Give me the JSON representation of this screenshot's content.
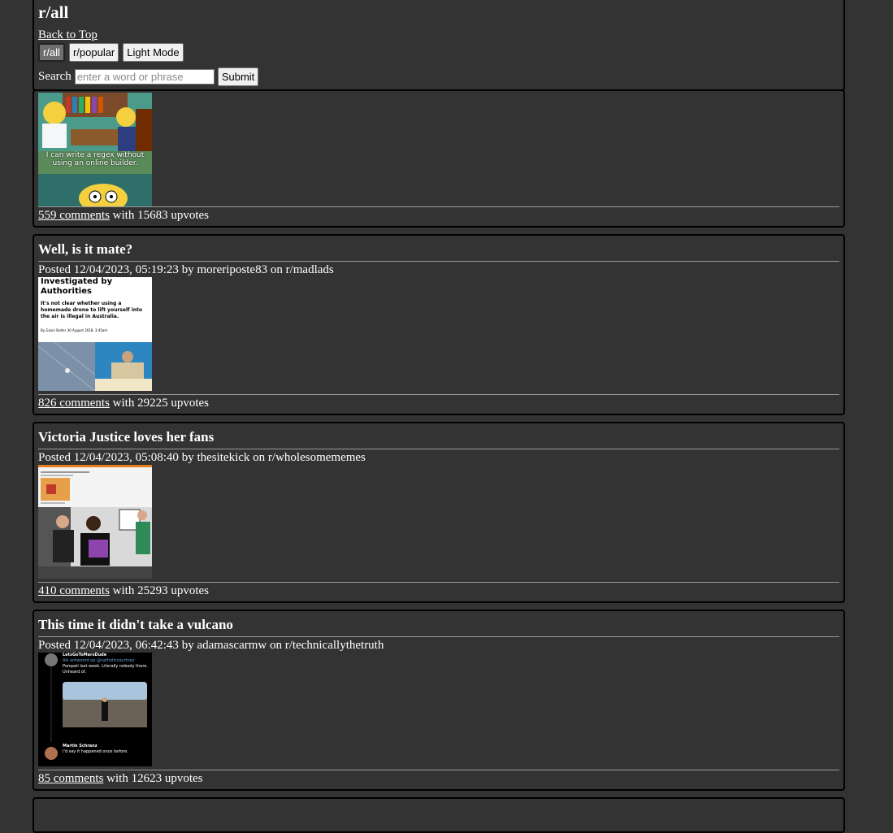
{
  "header": {
    "title": "r/all",
    "back_to_top": "Back to Top",
    "buttons": [
      "r/all",
      "r/popular",
      "Light Mode"
    ],
    "search_label": "Search",
    "search_placeholder": "enter a word or phrase",
    "submit_label": "Submit"
  },
  "first_post": {
    "image_caption": "I can write a regex without using an online builder.",
    "comments": "559 comments",
    "upvotes_text": "with 15683 upvotes"
  },
  "posts": [
    {
      "title": "Well, is it mate?",
      "posted_prefix": "Posted",
      "date": "12/04/2023, 05:19:23",
      "by": "by",
      "author": "moreriposte83",
      "on": "on",
      "subreddit": "r/madlads",
      "comments": "826 comments",
      "upvotes_text": "with 29225 upvotes",
      "thumb": {
        "headline": "Investigated by Authorities",
        "body": "It's not clear whether using a homemade drone to lift yourself into the air is illegal in Australia.",
        "byline": "By Gavin Butler",
        "dateline": "30 August 2018, 3:45am"
      }
    },
    {
      "title": "Victoria Justice loves her fans",
      "posted_prefix": "Posted",
      "date": "12/04/2023, 05:08:40",
      "by": "by",
      "author": "thesitekick",
      "on": "on",
      "subreddit": "r/wholesomememes",
      "comments": "410 comments",
      "upvotes_text": "with 25293 upvotes"
    },
    {
      "title": "This time it didn't take a vulcano",
      "posted_prefix": "Posted",
      "date": "12/04/2023, 06:42:43",
      "by": "by",
      "author": "adamascarmw",
      "on": "on",
      "subreddit": "r/technicallythetruth",
      "comments": "85 comments",
      "upvotes_text": "with 12623 upvotes",
      "thumb": {
        "user1": "LetsGoToMarsDude",
        "reply_to": "Als antwoord op @catholiccourtney",
        "text1": "Pompeii last week. Literally nobody there. Unheard of.",
        "user2": "Martin Schranz",
        "text2": "I'd say it happened once before."
      }
    }
  ],
  "colors": {
    "background": "#333333",
    "border": "#000000",
    "text": "#ffffff"
  }
}
